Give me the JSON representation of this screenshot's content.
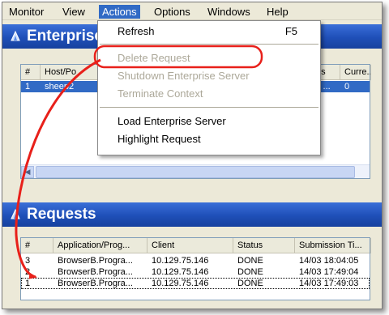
{
  "menubar": {
    "items": [
      "Monitor",
      "View",
      "Actions",
      "Options",
      "Windows",
      "Help"
    ]
  },
  "enterprise_panel": {
    "title": "Enterprise",
    "columns": [
      "#",
      "Host/Po",
      "us",
      "Curre..."
    ],
    "rows": [
      {
        "num": "1",
        "host": "sheep2",
        "status": "v ...",
        "current": "0"
      }
    ]
  },
  "actions_menu": {
    "refresh": {
      "label": "Refresh",
      "shortcut": "F5"
    },
    "delete_request": "Delete Request",
    "shutdown_server": "Shutdown Enterprise Server",
    "terminate_context": "Terminate Context",
    "load_server": "Load Enterprise Server",
    "highlight_request": "Highlight Request"
  },
  "requests_panel": {
    "title": "Requests",
    "columns": [
      "#",
      "Application/Prog...",
      "Client",
      "Status",
      "Submission Ti..."
    ],
    "rows": [
      {
        "num": "3",
        "app": "BrowserB.Progra...",
        "client": "10.129.75.146",
        "status": "DONE",
        "time": "14/03 18:04:05"
      },
      {
        "num": "2",
        "app": "BrowserB.Progra...",
        "client": "10.129.75.146",
        "status": "DONE",
        "time": "14/03 17:49:04"
      },
      {
        "num": "1",
        "app": "BrowserB.Progra...",
        "client": "10.129.75.146",
        "status": "DONE",
        "time": "14/03 17:49:03"
      }
    ]
  },
  "colors": {
    "title_bar": "#1f4fb8",
    "selection": "#316ac5",
    "annotation": "#e8201a",
    "disabled_text": "#aca899"
  }
}
